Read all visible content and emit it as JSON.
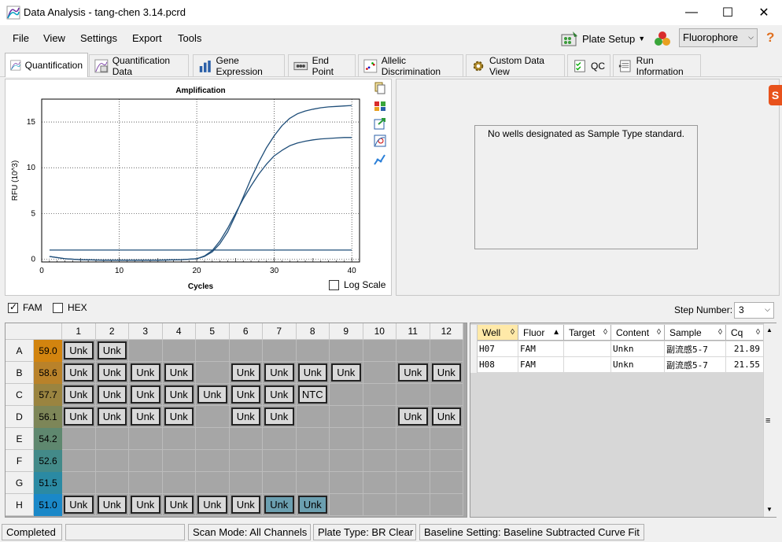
{
  "window": {
    "title": "Data Analysis - tang-chen 3.14.pcrd"
  },
  "menu": {
    "items": [
      "File",
      "View",
      "Settings",
      "Export",
      "Tools"
    ]
  },
  "toolbar": {
    "plate_setup": "Plate Setup",
    "fluor_select": "Fluorophore"
  },
  "tabs": [
    "Quantification",
    "Quantification Data",
    "Gene Expression",
    "End Point",
    "Allelic Discrimination",
    "Custom Data View",
    "QC",
    "Run Information"
  ],
  "active_tab": "Quantification",
  "std_curve_message": "No wells designated as Sample Type standard.",
  "log_scale_label": "Log Scale",
  "chart_data": {
    "type": "line",
    "title": "Amplification",
    "xlabel": "Cycles",
    "ylabel": "RFU (10^3)",
    "xlim": [
      0,
      41
    ],
    "ylim": [
      -0.3,
      17.5
    ],
    "xticks": [
      0,
      10,
      20,
      30,
      40
    ],
    "yticks": [
      0,
      5,
      10,
      15
    ],
    "grid": true,
    "series": [
      {
        "color": "#1f4e79",
        "x": [
          1,
          3,
          5,
          8,
          10,
          13,
          15,
          18,
          20,
          21,
          22,
          23,
          24,
          25,
          26,
          27,
          28,
          29,
          30,
          31,
          32,
          33,
          34,
          35,
          36,
          37,
          38,
          39,
          40
        ],
        "y": [
          0.3,
          0.05,
          -0.05,
          -0.1,
          -0.1,
          -0.1,
          -0.1,
          -0.05,
          0.05,
          0.3,
          0.8,
          1.7,
          3.0,
          4.8,
          6.8,
          8.8,
          10.6,
          12.2,
          13.5,
          14.6,
          15.4,
          15.9,
          16.2,
          16.4,
          16.55,
          16.65,
          16.7,
          16.75,
          16.8
        ]
      },
      {
        "color": "#1f4e79",
        "x": [
          1,
          3,
          5,
          8,
          10,
          13,
          15,
          18,
          20,
          21,
          22,
          23,
          24,
          25,
          26,
          27,
          28,
          29,
          30,
          31,
          32,
          33,
          34,
          35,
          36,
          37,
          38,
          39,
          40
        ],
        "y": [
          0.3,
          0.05,
          -0.05,
          -0.1,
          -0.1,
          -0.1,
          -0.1,
          -0.05,
          0.05,
          0.35,
          0.95,
          2.0,
          3.4,
          5.0,
          6.6,
          8.0,
          9.3,
          10.4,
          11.3,
          11.9,
          12.4,
          12.7,
          12.9,
          13.05,
          13.15,
          13.2,
          13.25,
          13.3,
          13.3
        ]
      },
      {
        "color": "#1f4e79",
        "x": [
          1,
          40
        ],
        "y": [
          1.0,
          1.0
        ]
      }
    ]
  },
  "fluors": [
    {
      "label": "FAM",
      "checked": true
    },
    {
      "label": "HEX",
      "checked": false
    }
  ],
  "step": {
    "label": "Step Number:",
    "value": "3"
  },
  "plate": {
    "cols": [
      "1",
      "2",
      "3",
      "4",
      "5",
      "6",
      "7",
      "8",
      "9",
      "10",
      "11",
      "12"
    ],
    "rows": [
      {
        "label": "A",
        "temp": "59.0",
        "color": "#d2840f",
        "wells": [
          "Unk",
          "Unk",
          "",
          "",
          "",
          "",
          "",
          "",
          "",
          "",
          "",
          ""
        ]
      },
      {
        "label": "B",
        "temp": "58.6",
        "color": "#b9822a",
        "wells": [
          "Unk",
          "Unk",
          "Unk",
          "Unk",
          "",
          "Unk",
          "Unk",
          "Unk",
          "Unk",
          "",
          "Unk",
          "Unk"
        ]
      },
      {
        "label": "C",
        "temp": "57.7",
        "color": "#9a8440",
        "wells": [
          "Unk",
          "Unk",
          "Unk",
          "Unk",
          "Unk",
          "Unk",
          "Unk",
          "NTC",
          "",
          "",
          "",
          ""
        ]
      },
      {
        "label": "D",
        "temp": "56.1",
        "color": "#7d8658",
        "wells": [
          "Unk",
          "Unk",
          "Unk",
          "Unk",
          "",
          "Unk",
          "Unk",
          "",
          "",
          "",
          "Unk",
          "Unk"
        ]
      },
      {
        "label": "E",
        "temp": "54.2",
        "color": "#5f886f",
        "wells": [
          "",
          "",
          "",
          "",
          "",
          "",
          "",
          "",
          "",
          "",
          "",
          ""
        ]
      },
      {
        "label": "F",
        "temp": "52.6",
        "color": "#438a89",
        "wells": [
          "",
          "",
          "",
          "",
          "",
          "",
          "",
          "",
          "",
          "",
          "",
          ""
        ]
      },
      {
        "label": "G",
        "temp": "51.5",
        "color": "#2b8aa3",
        "wells": [
          "",
          "",
          "",
          "",
          "",
          "",
          "",
          "",
          "",
          "",
          "",
          ""
        ]
      },
      {
        "label": "H",
        "temp": "51.0",
        "color": "#1a88c8",
        "wells": [
          "Unk",
          "Unk",
          "Unk",
          "Unk",
          "Unk",
          "Unk",
          "Unk",
          "Unk",
          "",
          "",
          "",
          ""
        ]
      }
    ],
    "selected": [
      "H7",
      "H8"
    ]
  },
  "table": {
    "headers": [
      "Well",
      "Fluor",
      "Target",
      "Content",
      "Sample",
      "Cq"
    ],
    "rows": [
      [
        "H07",
        "FAM",
        "",
        "Unkn",
        "副流感5-7",
        "21.89"
      ],
      [
        "H08",
        "FAM",
        "",
        "Unkn",
        "副流感5-7",
        "21.55"
      ]
    ]
  },
  "status": {
    "state": "Completed",
    "scan_mode": "Scan Mode: All Channels",
    "plate_type": "Plate Type: BR Clear",
    "baseline": "Baseline Setting: Baseline Subtracted Curve Fit"
  }
}
